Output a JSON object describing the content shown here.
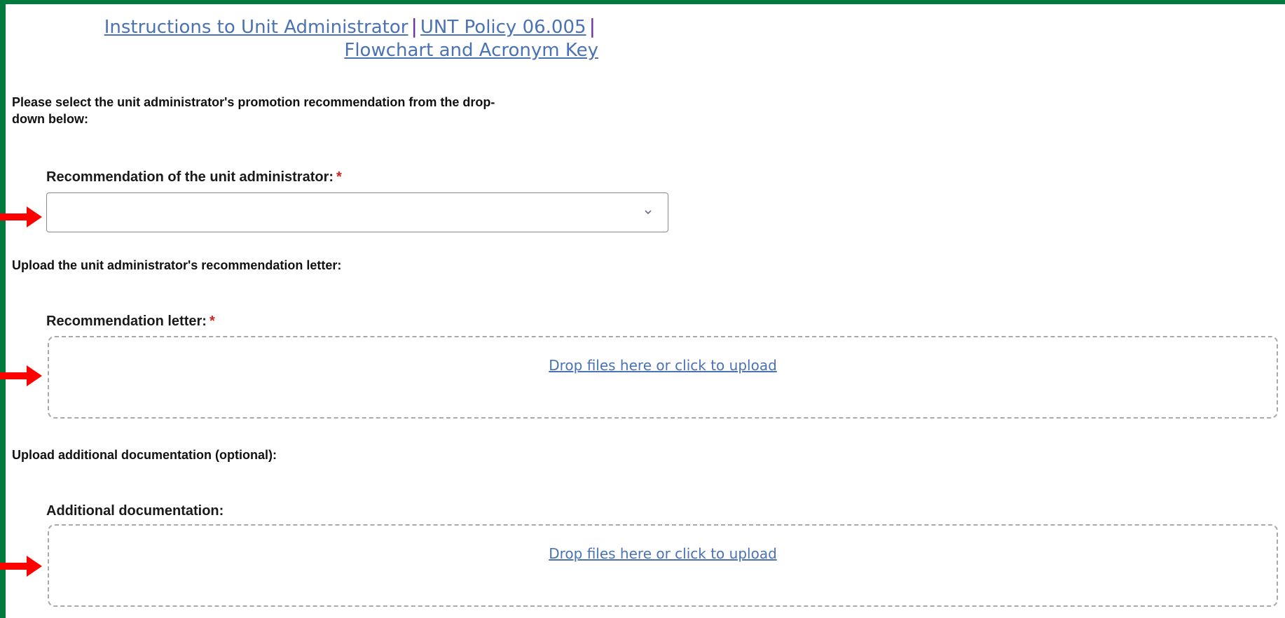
{
  "links": {
    "instructions": "Instructions to Unit Administrator",
    "separator": "|",
    "policy": "UNT Policy 06.005",
    "flowchart": "Flowchart and Acronym Key"
  },
  "section_recommendation": {
    "instruction": "Please select the unit administrator's promotion recommendation from the drop-down below:",
    "label": "Recommendation of the unit administrator:",
    "required_marker": "*",
    "selected_value": ""
  },
  "section_letter": {
    "instruction": "Upload the unit administrator's recommendation letter:",
    "label": "Recommendation letter:",
    "required_marker": "*",
    "dropzone_text": "Drop files here or click to upload"
  },
  "section_additional": {
    "instruction": "Upload additional documentation (optional):",
    "label": "Additional documentation:",
    "dropzone_text": "Drop files here or click to upload"
  },
  "colors": {
    "frame_green": "#007a3d",
    "link_blue": "#4a72b4",
    "required_red": "#d32020",
    "arrow_red": "#ff0000"
  },
  "icons": {
    "dropdown": "chevron-down-icon",
    "annotation": "red-arrow-icon"
  }
}
